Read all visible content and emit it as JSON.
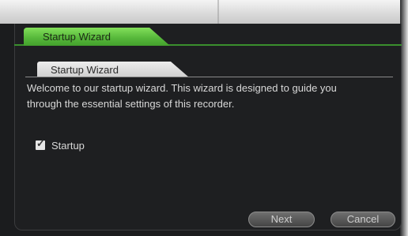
{
  "window": {
    "title": "Startup Wizard",
    "section_tab": "Startup Wizard",
    "welcome_text": "Welcome to our startup wizard. This wizard is designed to guide you through the essential settings of this recorder."
  },
  "startup_checkbox": {
    "label": "Startup",
    "checked": true
  },
  "buttons": {
    "next_label": "Next",
    "cancel_label": "Cancel"
  },
  "colors": {
    "title_tab_green": "#5cbc40",
    "background": "#1e1f21"
  }
}
